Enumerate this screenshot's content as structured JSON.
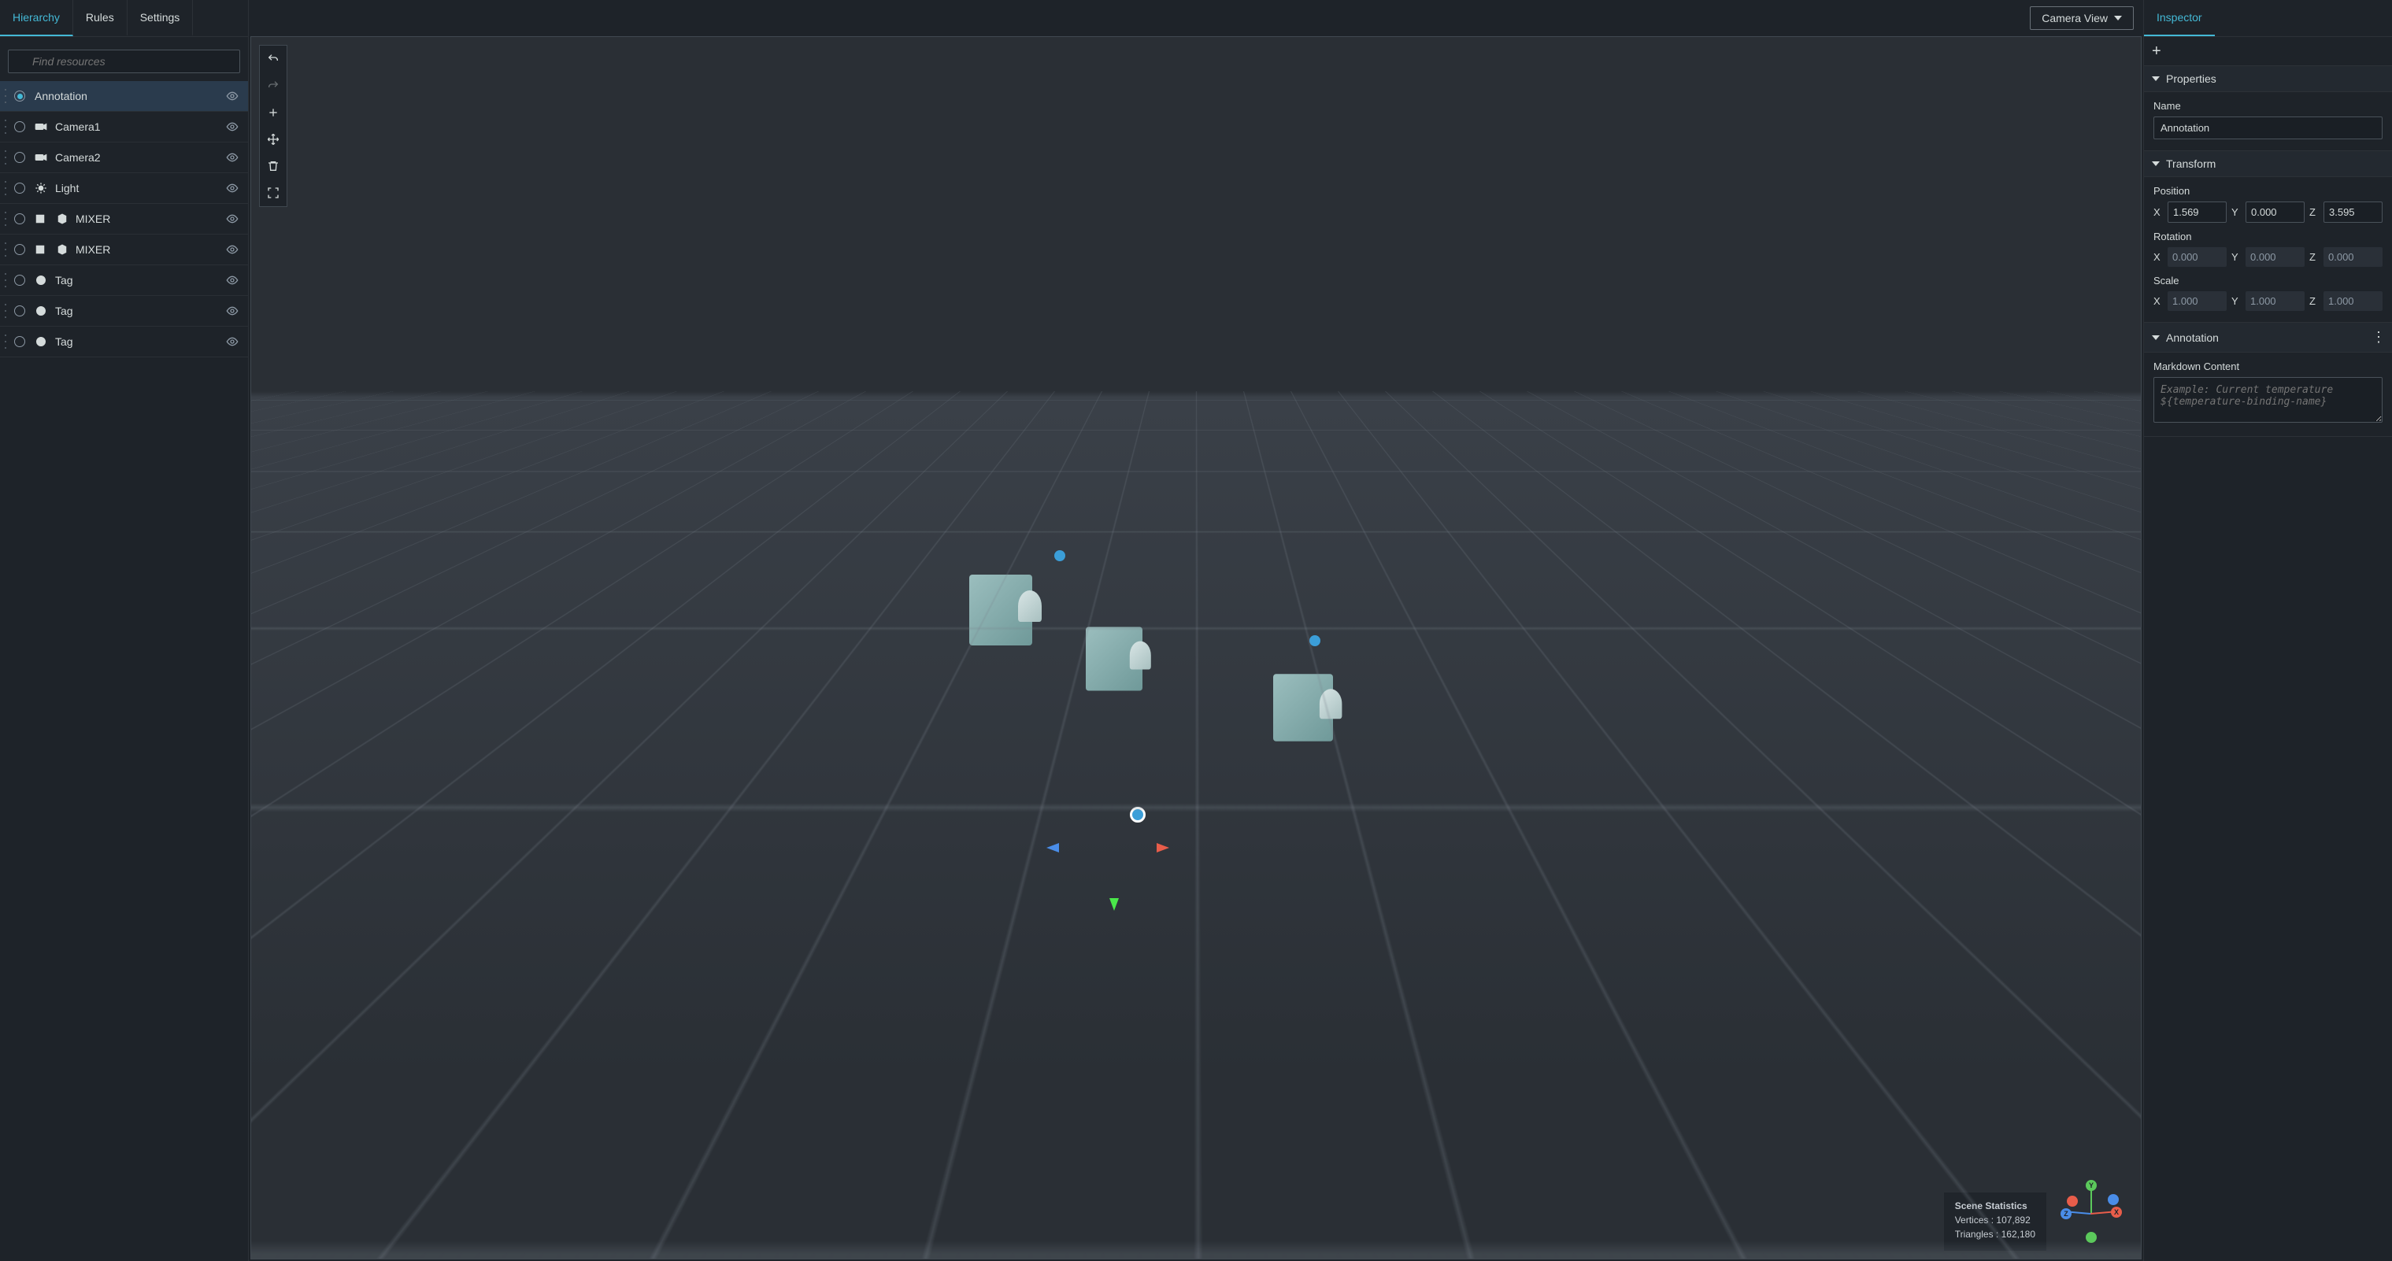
{
  "left": {
    "tabs": {
      "hierarchy": "Hierarchy",
      "rules": "Rules",
      "settings": "Settings"
    },
    "search_placeholder": "Find resources",
    "items": [
      {
        "label": "Annotation",
        "icon": "none",
        "selected": true
      },
      {
        "label": "Camera1",
        "icon": "camera",
        "selected": false
      },
      {
        "label": "Camera2",
        "icon": "camera",
        "selected": false
      },
      {
        "label": "Light",
        "icon": "light",
        "selected": false
      },
      {
        "label": "MIXER",
        "icon": "mixer",
        "selected": false
      },
      {
        "label": "MIXER",
        "icon": "mixer",
        "selected": false
      },
      {
        "label": "Tag",
        "icon": "tag",
        "selected": false
      },
      {
        "label": "Tag",
        "icon": "tag",
        "selected": false
      },
      {
        "label": "Tag",
        "icon": "tag",
        "selected": false
      }
    ]
  },
  "center": {
    "camera_view_label": "Camera View",
    "stats": {
      "title": "Scene Statistics",
      "vertices_label": "Vertices :",
      "vertices_value": "107,892",
      "triangles_label": "Triangles :",
      "triangles_value": "162,180"
    }
  },
  "right": {
    "tab_label": "Inspector",
    "sections": {
      "properties": {
        "title": "Properties",
        "name_label": "Name",
        "name_value": "Annotation"
      },
      "transform": {
        "title": "Transform",
        "position_label": "Position",
        "rotation_label": "Rotation",
        "scale_label": "Scale",
        "position": {
          "x": "1.569",
          "y": "0.000",
          "z": "3.595"
        },
        "rotation": {
          "x": "0.000",
          "y": "0.000",
          "z": "0.000"
        },
        "scale": {
          "x": "1.000",
          "y": "1.000",
          "z": "1.000"
        }
      },
      "annotation": {
        "title": "Annotation",
        "markdown_label": "Markdown Content",
        "markdown_placeholder": "Example: Current temperature ${temperature-binding-name}"
      }
    },
    "axis_labels": {
      "x": "X",
      "y": "Y",
      "z": "Z"
    }
  }
}
